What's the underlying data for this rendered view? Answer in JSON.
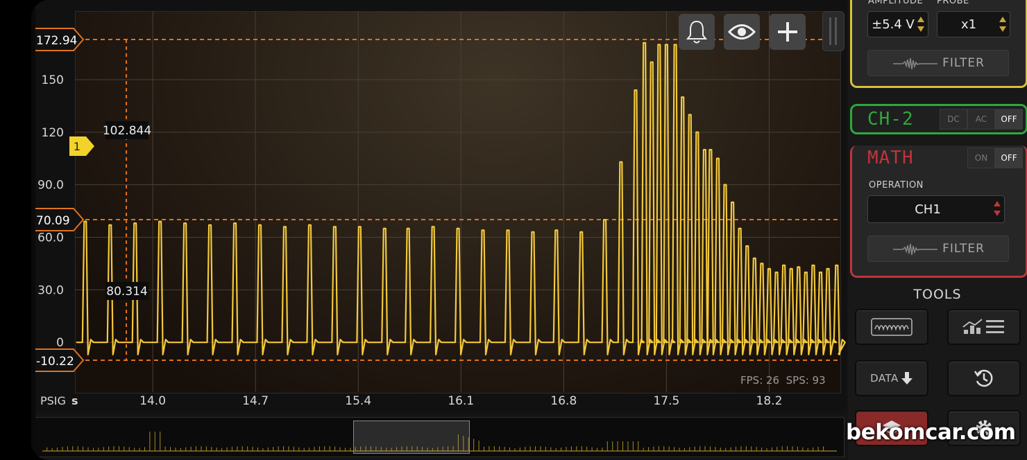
{
  "colors": {
    "trace": "#f3c93a",
    "cursor": "#e0721f",
    "ch1": "#d7c23a",
    "ch2": "#2fa83b",
    "math": "#c0343a"
  },
  "scope": {
    "y_unit": "PSIG",
    "x_unit": "s",
    "y_ticks": [
      "150",
      "120",
      "90.0",
      "60.0",
      "30.0",
      "0"
    ],
    "y_tick_values": [
      150,
      120,
      90,
      60,
      30,
      0
    ],
    "x_ticks": [
      "14.0",
      "14.7",
      "15.4",
      "16.1",
      "16.8",
      "17.5",
      "18.2"
    ],
    "x_tick_values": [
      14.0,
      14.7,
      15.4,
      16.1,
      16.8,
      17.5,
      18.2
    ],
    "x_range": [
      13.47,
      18.68
    ],
    "y_range": [
      -10.22,
      172.94
    ],
    "cursor_upper_label": "172.94",
    "cursor_mid_label": "70.09",
    "cursor_lower_label": "-10.22",
    "cursor_upper_value": 172.94,
    "cursor_mid_value": 70.09,
    "cursor_lower_value": -10.22,
    "vertical_cursor_time": 13.82,
    "readout_a": "102.844",
    "readout_b": "80.314",
    "trigger_marker": "1",
    "trigger_level": 112,
    "stats": "FPS: 26  SPS: 93",
    "icons": [
      "bell-icon",
      "eye-icon",
      "plus-icon"
    ]
  },
  "chart_data": {
    "type": "line",
    "title": "",
    "xlabel": "s",
    "ylabel": "PSIG",
    "xlim": [
      13.47,
      18.68
    ],
    "ylim": [
      -10.22,
      172.94
    ],
    "grid": true,
    "series": [
      {
        "peak_times": [
          13.54,
          13.71,
          13.88,
          14.05,
          14.22,
          14.39,
          14.56,
          14.73,
          14.9,
          15.07,
          15.24,
          15.41,
          15.58,
          15.74,
          15.91,
          16.08,
          16.25,
          16.42,
          16.59,
          16.75,
          16.92,
          17.08,
          17.19,
          17.29,
          17.35,
          17.4,
          17.45,
          17.5,
          17.56,
          17.61,
          17.66,
          17.71,
          17.76,
          17.8,
          17.85,
          17.9,
          17.95,
          18.0,
          18.05,
          18.1,
          18.15,
          18.2,
          18.25,
          18.3,
          18.35,
          18.4,
          18.45,
          18.5,
          18.55,
          18.6,
          18.66
        ],
        "peak_values": [
          69,
          67,
          68,
          69,
          68,
          67,
          68,
          67,
          66,
          67,
          66,
          66,
          65,
          65,
          66,
          65,
          64,
          64,
          63,
          64,
          63,
          70,
          103,
          144,
          171,
          160,
          170,
          170,
          170,
          140,
          130,
          120,
          110,
          110,
          105,
          90,
          80,
          65,
          55,
          48,
          45,
          42,
          40,
          44,
          42,
          43,
          40,
          44,
          40,
          42,
          44
        ]
      }
    ]
  },
  "channel1": {
    "amplitude_label": "AMPLITUDE",
    "probe_label": "PROBE",
    "amplitude_value": "±5.4 V",
    "probe_value": "x1",
    "filter_label": "FILTER"
  },
  "channel2": {
    "title": "CH-2",
    "modes": [
      "DC",
      "AC",
      "OFF"
    ],
    "selected": "OFF"
  },
  "math": {
    "title": "MATH",
    "modes": [
      "ON",
      "OFF"
    ],
    "selected": "OFF",
    "operation_label": "OPERATION",
    "operation_value": "CH1",
    "filter_label": "FILTER"
  },
  "tools": {
    "title": "TOOLS",
    "data_label": "DATA"
  },
  "watermark": "bekomcar.com"
}
